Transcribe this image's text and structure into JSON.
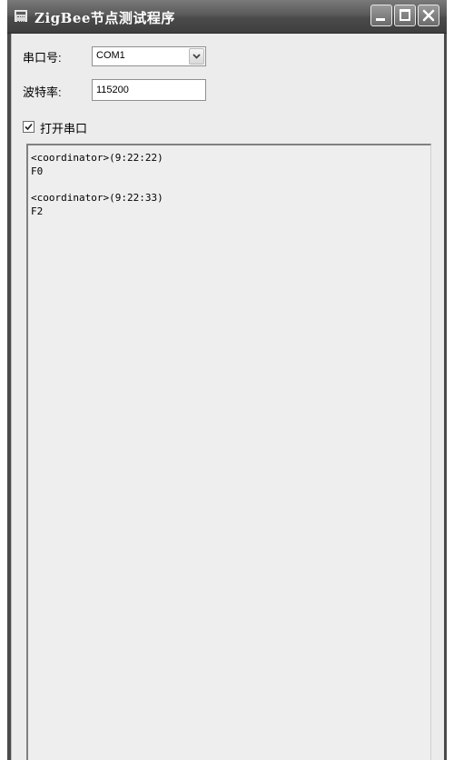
{
  "window": {
    "title": "ZigBee节点测试程序",
    "icons": {
      "app": "app-window-icon",
      "minimize": "minimize-icon",
      "maximize": "maximize-icon",
      "close": "close-icon"
    }
  },
  "serial": {
    "port_label": "串口号:",
    "port_value": "COM1",
    "port_dropdown_icon": "chevron-down-icon",
    "baud_label": "波特率:",
    "baud_value": "115200",
    "open_port_label": "打开串口",
    "open_port_checked": true
  },
  "log": {
    "entries": [
      {
        "header": "<coordinator>(9:22:22)",
        "data": "F0"
      },
      {
        "header": "<coordinator>(9:22:33)",
        "data": "F2"
      }
    ]
  },
  "colors": {
    "titlebar": "#4b4b4b",
    "client_background": "#ececec",
    "log_background": "#eeeeee"
  }
}
